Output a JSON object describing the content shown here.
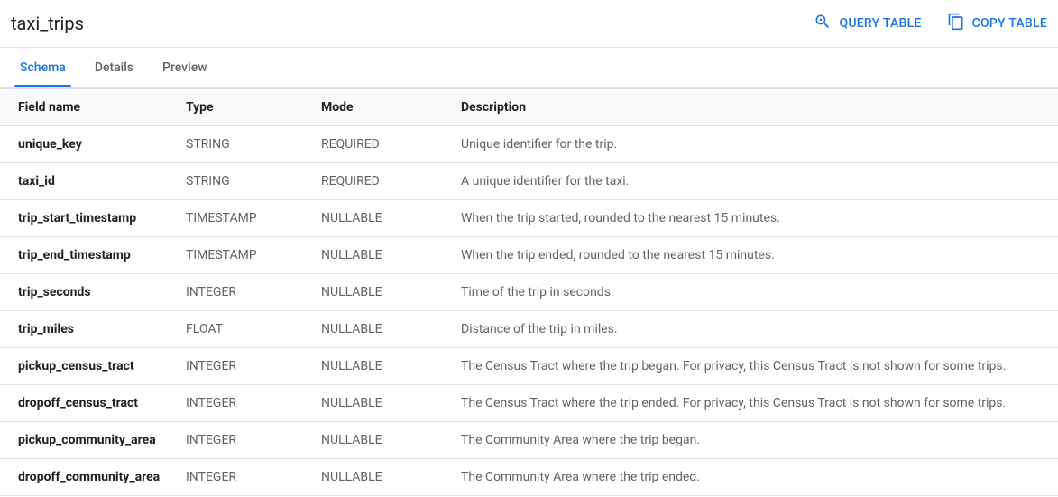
{
  "header": {
    "title": "taxi_trips",
    "query_button": "QUERY TABLE",
    "copy_button": "COPY TABLE"
  },
  "tabs": [
    {
      "label": "Schema",
      "active": true
    },
    {
      "label": "Details",
      "active": false
    },
    {
      "label": "Preview",
      "active": false
    }
  ],
  "schema": {
    "headers": {
      "field_name": "Field name",
      "type": "Type",
      "mode": "Mode",
      "description": "Description"
    },
    "fields": [
      {
        "name": "unique_key",
        "type": "STRING",
        "mode": "REQUIRED",
        "description": "Unique identifier for the trip."
      },
      {
        "name": "taxi_id",
        "type": "STRING",
        "mode": "REQUIRED",
        "description": "A unique identifier for the taxi."
      },
      {
        "name": "trip_start_timestamp",
        "type": "TIMESTAMP",
        "mode": "NULLABLE",
        "description": "When the trip started, rounded to the nearest 15 minutes."
      },
      {
        "name": "trip_end_timestamp",
        "type": "TIMESTAMP",
        "mode": "NULLABLE",
        "description": "When the trip ended, rounded to the nearest 15 minutes."
      },
      {
        "name": "trip_seconds",
        "type": "INTEGER",
        "mode": "NULLABLE",
        "description": "Time of the trip in seconds."
      },
      {
        "name": "trip_miles",
        "type": "FLOAT",
        "mode": "NULLABLE",
        "description": "Distance of the trip in miles."
      },
      {
        "name": "pickup_census_tract",
        "type": "INTEGER",
        "mode": "NULLABLE",
        "description": "The Census Tract where the trip began. For privacy, this Census Tract is not shown for some trips."
      },
      {
        "name": "dropoff_census_tract",
        "type": "INTEGER",
        "mode": "NULLABLE",
        "description": "The Census Tract where the trip ended. For privacy, this Census Tract is not shown for some trips."
      },
      {
        "name": "pickup_community_area",
        "type": "INTEGER",
        "mode": "NULLABLE",
        "description": "The Community Area where the trip began."
      },
      {
        "name": "dropoff_community_area",
        "type": "INTEGER",
        "mode": "NULLABLE",
        "description": "The Community Area where the trip ended."
      }
    ]
  }
}
